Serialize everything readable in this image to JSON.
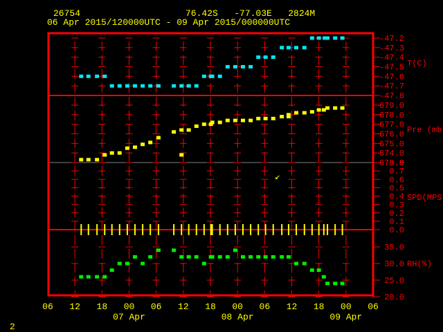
{
  "header": {
    "station_id": "26754",
    "location": "76.42S   -77.03E   2824M",
    "period": "06 Apr 2015/120000UTC - 09 Apr 2015/000000UTC"
  },
  "page_number": "2",
  "colors": {
    "frame": "#ff0000",
    "axis_text": "#ff0000",
    "time_text": "#ffff00",
    "temperature": "#00e8f0",
    "pressure": "#ffff00",
    "speed": "#ffff00",
    "rh": "#00ee00"
  },
  "chart_data": {
    "type": "scatter",
    "x_unit": "hours since 06 Apr 2015 06UTC",
    "xlim": [
      0,
      72
    ],
    "x_ticks": [
      {
        "h": 0,
        "label": "06"
      },
      {
        "h": 6,
        "label": "12"
      },
      {
        "h": 12,
        "label": "18"
      },
      {
        "h": 18,
        "label": "00"
      },
      {
        "h": 24,
        "label": "06"
      },
      {
        "h": 30,
        "label": "12"
      },
      {
        "h": 36,
        "label": "18"
      },
      {
        "h": 42,
        "label": "00"
      },
      {
        "h": 48,
        "label": "06"
      },
      {
        "h": 54,
        "label": "12"
      },
      {
        "h": 60,
        "label": "18"
      },
      {
        "h": 66,
        "label": "00"
      },
      {
        "h": 72,
        "label": "06"
      }
    ],
    "date_labels": [
      {
        "h": 18,
        "label": "07 Apr"
      },
      {
        "h": 42,
        "label": "08 Apr"
      },
      {
        "h": 66,
        "label": "09 Apr"
      }
    ],
    "wind_direction_glyph": "↙",
    "panels": [
      {
        "id": "temperature",
        "ylabel": "T(C)",
        "ylim": [
          -47.8,
          -47.2
        ],
        "ticks": [
          "-47.2",
          "-47.3",
          "-47.4",
          "-47.5",
          "-47.6",
          "-47.7",
          "-47.8"
        ],
        "points": [
          [
            7.4,
            -47.6
          ],
          [
            9.0,
            -47.6
          ],
          [
            10.9,
            -47.6
          ],
          [
            12.6,
            -47.6
          ],
          [
            14.2,
            -47.7
          ],
          [
            15.9,
            -47.7
          ],
          [
            17.6,
            -47.7
          ],
          [
            19.3,
            -47.7
          ],
          [
            21.0,
            -47.7
          ],
          [
            22.7,
            -47.7
          ],
          [
            24.5,
            -47.7
          ],
          [
            27.9,
            -47.7
          ],
          [
            29.6,
            -47.7
          ],
          [
            31.2,
            -47.7
          ],
          [
            32.9,
            -47.7
          ],
          [
            34.6,
            -47.6
          ],
          [
            36.1,
            -47.6
          ],
          [
            36.4,
            -47.6
          ],
          [
            38.1,
            -47.6
          ],
          [
            39.8,
            -47.5
          ],
          [
            41.5,
            -47.5
          ],
          [
            43.2,
            -47.5
          ],
          [
            44.9,
            -47.5
          ],
          [
            46.6,
            -47.4
          ],
          [
            48.2,
            -47.4
          ],
          [
            49.9,
            -47.4
          ],
          [
            51.8,
            -47.3
          ],
          [
            53.3,
            -47.3
          ],
          [
            55.0,
            -47.3
          ],
          [
            56.8,
            -47.3
          ],
          [
            58.5,
            -47.2
          ],
          [
            60.0,
            -47.2
          ],
          [
            61.3,
            -47.2
          ],
          [
            61.9,
            -47.2
          ],
          [
            63.6,
            -47.2
          ],
          [
            65.2,
            -47.2
          ]
        ]
      },
      {
        "id": "pressure",
        "ylabel": "Pre (mb)",
        "ylim": [
          673.0,
          679.0
        ],
        "ticks": [
          "679.0",
          "678.0",
          "677.0",
          "676.0",
          "675.0",
          "674.0",
          "673.0"
        ],
        "points": [
          [
            7.4,
            673.3
          ],
          [
            9.0,
            673.3
          ],
          [
            10.9,
            673.3
          ],
          [
            12.6,
            673.8
          ],
          [
            14.2,
            674.0
          ],
          [
            15.9,
            674.0
          ],
          [
            17.6,
            674.5
          ],
          [
            19.3,
            674.6
          ],
          [
            21.0,
            674.9
          ],
          [
            22.7,
            675.1
          ],
          [
            24.5,
            675.6
          ],
          [
            27.9,
            676.2
          ],
          [
            29.6,
            673.8
          ],
          [
            29.6,
            676.4
          ],
          [
            31.2,
            676.4
          ],
          [
            32.9,
            676.8
          ],
          [
            34.6,
            677.0
          ],
          [
            36.1,
            677.0
          ],
          [
            36.4,
            677.2
          ],
          [
            38.1,
            677.2
          ],
          [
            39.8,
            677.4
          ],
          [
            41.5,
            677.4
          ],
          [
            43.2,
            677.4
          ],
          [
            44.9,
            677.4
          ],
          [
            46.6,
            677.6
          ],
          [
            48.2,
            677.6
          ],
          [
            49.9,
            677.6
          ],
          [
            51.8,
            677.8
          ],
          [
            53.3,
            678.0
          ],
          [
            53.3,
            677.8
          ],
          [
            55.0,
            678.2
          ],
          [
            56.8,
            678.2
          ],
          [
            58.5,
            678.3
          ],
          [
            60.0,
            678.5
          ],
          [
            61.1,
            678.5
          ],
          [
            61.9,
            678.7
          ],
          [
            63.6,
            678.7
          ],
          [
            65.2,
            678.7
          ]
        ]
      },
      {
        "id": "speed",
        "ylabel": "SPD(MPS)",
        "ylim": [
          0.0,
          0.8
        ],
        "ticks": [
          "0.8",
          "0.7",
          "0.6",
          "0.5",
          "0.4",
          "0.3",
          "0.2",
          "0.1",
          "0.0"
        ],
        "points": [
          [
            7.4,
            0
          ],
          [
            9.0,
            0
          ],
          [
            10.9,
            0
          ],
          [
            12.6,
            0
          ],
          [
            14.2,
            0
          ],
          [
            15.9,
            0
          ],
          [
            17.6,
            0
          ],
          [
            19.3,
            0
          ],
          [
            21.0,
            0
          ],
          [
            22.7,
            0
          ],
          [
            24.5,
            0
          ],
          [
            27.9,
            0
          ],
          [
            29.6,
            0
          ],
          [
            31.2,
            0
          ],
          [
            32.9,
            0
          ],
          [
            34.6,
            0
          ],
          [
            36.1,
            0
          ],
          [
            36.4,
            0
          ],
          [
            38.1,
            0
          ],
          [
            39.8,
            0
          ],
          [
            41.5,
            0
          ],
          [
            43.2,
            0
          ],
          [
            44.9,
            0
          ],
          [
            46.6,
            0
          ],
          [
            48.2,
            0
          ],
          [
            49.9,
            0
          ],
          [
            51.8,
            0
          ],
          [
            53.3,
            0
          ],
          [
            55.0,
            0
          ],
          [
            56.8,
            0
          ],
          [
            58.5,
            0
          ],
          [
            60.0,
            0
          ],
          [
            61.1,
            0
          ],
          [
            61.9,
            0
          ],
          [
            63.6,
            0
          ],
          [
            65.2,
            0
          ]
        ]
      },
      {
        "id": "rh",
        "ylabel": "RH(%)",
        "ylim": [
          20.0,
          35.0
        ],
        "ticks": [
          "35.0",
          "30.0",
          "25.0",
          "20.0"
        ],
        "points": [
          [
            7.4,
            26
          ],
          [
            9.0,
            26
          ],
          [
            10.9,
            26
          ],
          [
            12.6,
            26
          ],
          [
            14.2,
            28
          ],
          [
            15.9,
            30
          ],
          [
            17.6,
            30
          ],
          [
            19.3,
            32
          ],
          [
            21.0,
            30
          ],
          [
            22.7,
            32
          ],
          [
            24.5,
            34
          ],
          [
            27.9,
            34
          ],
          [
            29.6,
            32
          ],
          [
            31.2,
            32
          ],
          [
            32.9,
            32
          ],
          [
            34.6,
            30
          ],
          [
            36.1,
            32
          ],
          [
            36.4,
            32
          ],
          [
            38.1,
            32
          ],
          [
            39.8,
            32
          ],
          [
            41.5,
            34
          ],
          [
            43.2,
            32
          ],
          [
            44.9,
            32
          ],
          [
            46.6,
            32
          ],
          [
            48.2,
            32
          ],
          [
            49.9,
            32
          ],
          [
            51.8,
            32
          ],
          [
            53.3,
            32
          ],
          [
            55.0,
            30
          ],
          [
            56.8,
            30
          ],
          [
            58.5,
            28
          ],
          [
            60.0,
            28
          ],
          [
            61.1,
            26
          ],
          [
            61.9,
            24
          ],
          [
            63.6,
            24
          ],
          [
            65.2,
            24
          ]
        ]
      }
    ]
  }
}
